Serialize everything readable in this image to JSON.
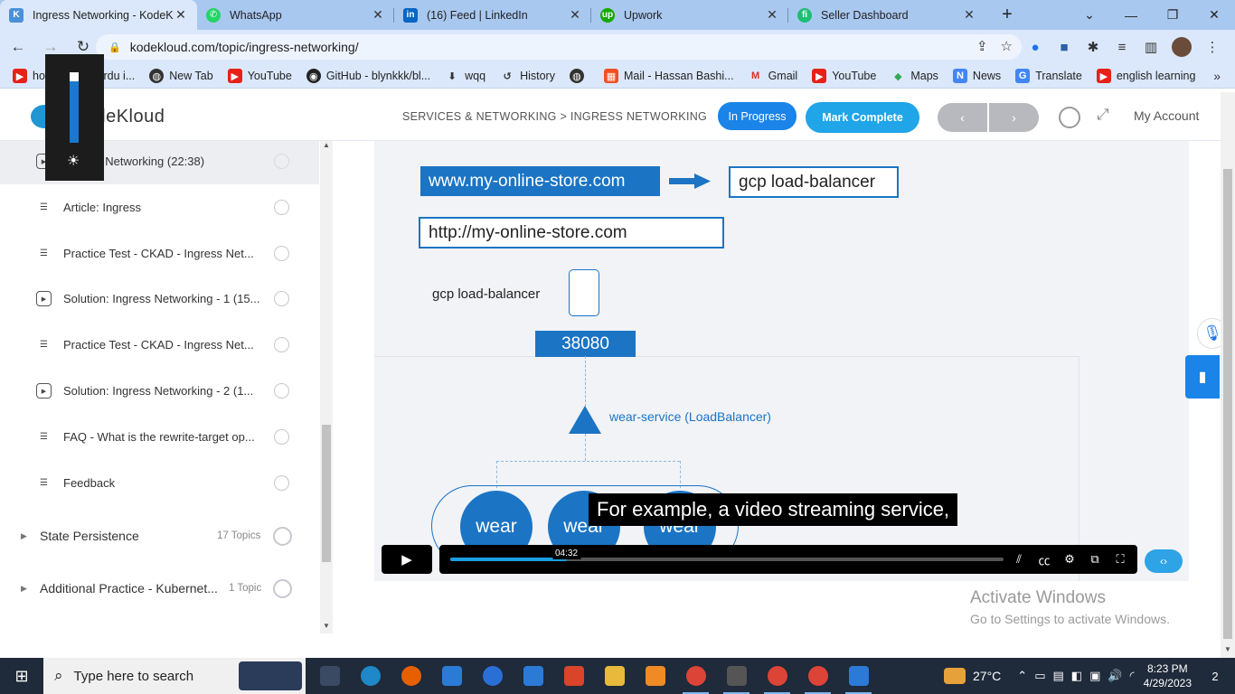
{
  "browser": {
    "tabs": [
      {
        "title": "Ingress Networking - KodeKl",
        "favicon_color": "#4a90d9",
        "active": true
      },
      {
        "title": "WhatsApp",
        "favicon_color": "#25d366",
        "active": false
      },
      {
        "title": "(16) Feed | LinkedIn",
        "favicon_color": "#0a66c2",
        "active": false
      },
      {
        "title": "Upwork",
        "favicon_color": "#14a800",
        "active": false
      },
      {
        "title": "Seller Dashboard",
        "favicon_color": "#1dbf73",
        "active": false
      }
    ],
    "url": "kodekloud.com/topic/ingress-networking/",
    "bookmarks": [
      {
        "label": "how to learn urdu i...",
        "icon_color": "#e62117"
      },
      {
        "label": "New Tab",
        "icon_color": "#333333"
      },
      {
        "label": "YouTube",
        "icon_color": "#e62117"
      },
      {
        "label": "GitHub - blynkkk/bl...",
        "icon_color": "#222222"
      },
      {
        "label": "wqq",
        "icon_color": "#333333"
      },
      {
        "label": "History",
        "icon_color": "#333333"
      },
      {
        "label": "",
        "icon_color": "#333333"
      },
      {
        "label": "Mail - Hassan Bashi...",
        "icon_color": "#f25022"
      },
      {
        "label": "Gmail",
        "icon_color": "#d93025"
      },
      {
        "label": "YouTube",
        "icon_color": "#e62117"
      },
      {
        "label": "Maps",
        "icon_color": "#34a853"
      },
      {
        "label": "News",
        "icon_color": "#4285f4"
      },
      {
        "label": "Translate",
        "icon_color": "#4285f4"
      },
      {
        "label": "english learning",
        "icon_color": "#e62117"
      }
    ]
  },
  "site": {
    "logo_text": "KodeKloud",
    "breadcrumb": "SERVICES & NETWORKING > INGRESS NETWORKING",
    "status_label": "In Progress",
    "mark_complete_label": "Mark Complete",
    "account_label": "My Account",
    "prev_glyph": "‹",
    "next_glyph": "›"
  },
  "sidebar": {
    "lessons": [
      {
        "title": "Ingress Networking (22:38)",
        "type": "video",
        "current": true
      },
      {
        "title": "Article: Ingress",
        "type": "article",
        "current": false
      },
      {
        "title": "Practice Test - CKAD - Ingress Net...",
        "type": "article",
        "current": false
      },
      {
        "title": "Solution: Ingress Networking - 1 (15...",
        "type": "video",
        "current": false
      },
      {
        "title": "Practice Test - CKAD - Ingress Net...",
        "type": "article",
        "current": false
      },
      {
        "title": "Solution: Ingress Networking - 2 (1...",
        "type": "video",
        "current": false
      },
      {
        "title": "FAQ - What is the rewrite-target op...",
        "type": "article",
        "current": false
      },
      {
        "title": "Feedback",
        "type": "article",
        "current": false
      }
    ],
    "sections": [
      {
        "title": "State Persistence",
        "count": "17 Topics"
      },
      {
        "title": "Additional Practice - Kubernet...",
        "count": "1 Topic"
      }
    ]
  },
  "video": {
    "slide": {
      "domain": "www.my-online-store.com",
      "lb_label": "gcp load-balancer",
      "http_url": "http://my-online-store.com",
      "lb_small_label": "gcp load-balancer",
      "port": "38080",
      "service_label": "wear-service (LoadBalancer)",
      "pods": [
        "wear",
        "wear",
        "wear"
      ]
    },
    "caption": "For example, a video streaming service,",
    "current_time": "04:32",
    "progress_fraction": 0.21
  },
  "watermark": {
    "line1": "Activate Windows",
    "line2": "Go to Settings to activate Windows."
  },
  "taskbar": {
    "search_placeholder": "Type here to search",
    "apps": [
      {
        "name": "task-view",
        "color": "#3a4a63"
      },
      {
        "name": "edge",
        "color": "#1e88c8"
      },
      {
        "name": "firefox",
        "color": "#e66000"
      },
      {
        "name": "store",
        "color": "#2b7bd6"
      },
      {
        "name": "skype",
        "color": "#2a6fd6"
      },
      {
        "name": "mail",
        "color": "#2b7bd6"
      },
      {
        "name": "app-red",
        "color": "#d9442a"
      },
      {
        "name": "file-explorer",
        "color": "#e8b93a"
      },
      {
        "name": "app-orange",
        "color": "#f08a24"
      },
      {
        "name": "chrome",
        "color": "#db4437"
      },
      {
        "name": "app-dark",
        "color": "#555555"
      },
      {
        "name": "chrome-2",
        "color": "#db4437"
      },
      {
        "name": "chrome-3",
        "color": "#db4437"
      },
      {
        "name": "photos",
        "color": "#2b7bd6"
      }
    ],
    "temperature": "27°C",
    "time": "8:23 PM",
    "date": "4/29/2023",
    "notification_count": "2"
  }
}
